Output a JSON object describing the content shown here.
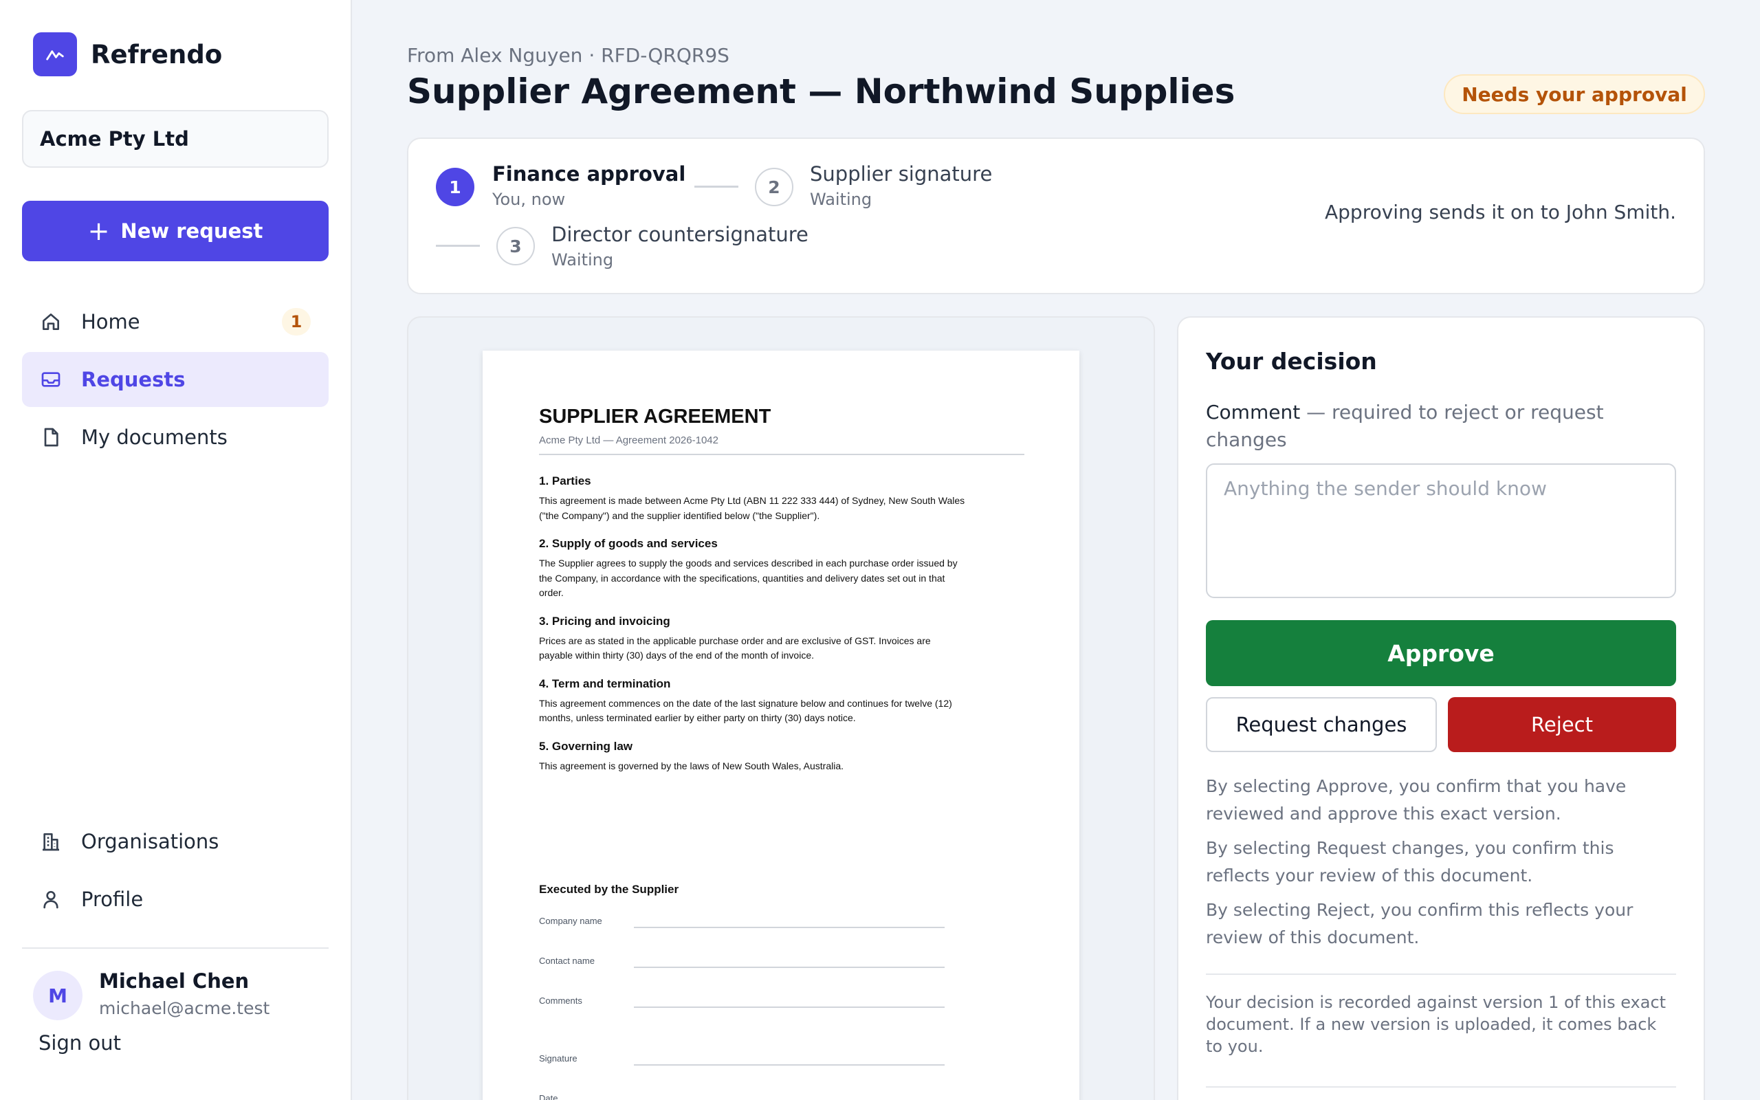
{
  "app": {
    "name": "Refrendo"
  },
  "sidebar": {
    "org": "Acme Pty Ltd",
    "new_request_label": "New request",
    "nav": [
      {
        "label": "Home",
        "icon": "home-icon",
        "badge": "1"
      },
      {
        "label": "Requests",
        "icon": "inbox-icon",
        "active": true
      },
      {
        "label": "My documents",
        "icon": "document-icon"
      }
    ],
    "nav_bottom": [
      {
        "label": "Organisations",
        "icon": "building-icon"
      },
      {
        "label": "Profile",
        "icon": "user-icon"
      }
    ],
    "user": {
      "initial": "M",
      "name": "Michael Chen",
      "email": "michael@acme.test"
    },
    "sign_out": "Sign out"
  },
  "header": {
    "from_line": "From Alex Nguyen · RFD-QRQR9S",
    "title": "Supplier Agreement — Northwind Supplies",
    "status": "Needs your approval"
  },
  "steps": [
    {
      "number": "1",
      "label": "Finance approval",
      "sub": "You, now",
      "state": "current"
    },
    {
      "number": "2",
      "label": "Supplier signature",
      "sub": "Waiting",
      "state": "pending"
    },
    {
      "number": "3",
      "label": "Director countersignature",
      "sub": "Waiting",
      "state": "pending"
    }
  ],
  "steps_note": "Approving sends it on to John Smith.",
  "document": {
    "title": "SUPPLIER AGREEMENT",
    "subtitle": "Acme Pty Ltd — Agreement 2026-1042",
    "sections": [
      {
        "heading": "1. Parties",
        "body": "This agreement is made between Acme Pty Ltd (ABN 11 222 333 444) of Sydney, New South Wales (\"the Company\") and the supplier identified below (\"the Supplier\")."
      },
      {
        "heading": "2. Supply of goods and services",
        "body": "The Supplier agrees to supply the goods and services described in each purchase order issued by the Company, in accordance with the specifications, quantities and delivery dates set out in that order."
      },
      {
        "heading": "3. Pricing and invoicing",
        "body": "Prices are as stated in the applicable purchase order and are exclusive of GST. Invoices are payable within thirty (30) days of the end of the month of invoice."
      },
      {
        "heading": "4. Term and termination",
        "body": "This agreement commences on the date of the last signature below and continues for twelve (12) months, unless terminated earlier by either party on thirty (30) days notice."
      },
      {
        "heading": "5. Governing law",
        "body": "This agreement is governed by the laws of New South Wales, Australia."
      }
    ],
    "executed_title": "Executed by the Supplier",
    "fields": [
      "Company name",
      "Contact name",
      "Comments",
      "Signature",
      "Date"
    ]
  },
  "decision": {
    "title": "Your decision",
    "comment_label_main": "Comment",
    "comment_label_hint": " — required to reject or request changes",
    "comment_placeholder": "Anything the sender should know",
    "comment_value": "",
    "approve_label": "Approve",
    "request_changes_label": "Request changes",
    "reject_label": "Reject",
    "confirmations": [
      "By selecting Approve, you confirm that you have reviewed and approve this exact version.",
      "By selecting Request changes, you confirm this reflects your review of this document.",
      "By selecting Reject, you confirm this reflects your review of this document."
    ],
    "record_note": "Your decision is recorded against version 1 of this exact document. If a new version is uploaded, it comes back to you."
  },
  "colors": {
    "accent": "#4f46e5",
    "approve": "#15803d",
    "reject": "#b91c1c",
    "warning_text": "#b45309"
  }
}
